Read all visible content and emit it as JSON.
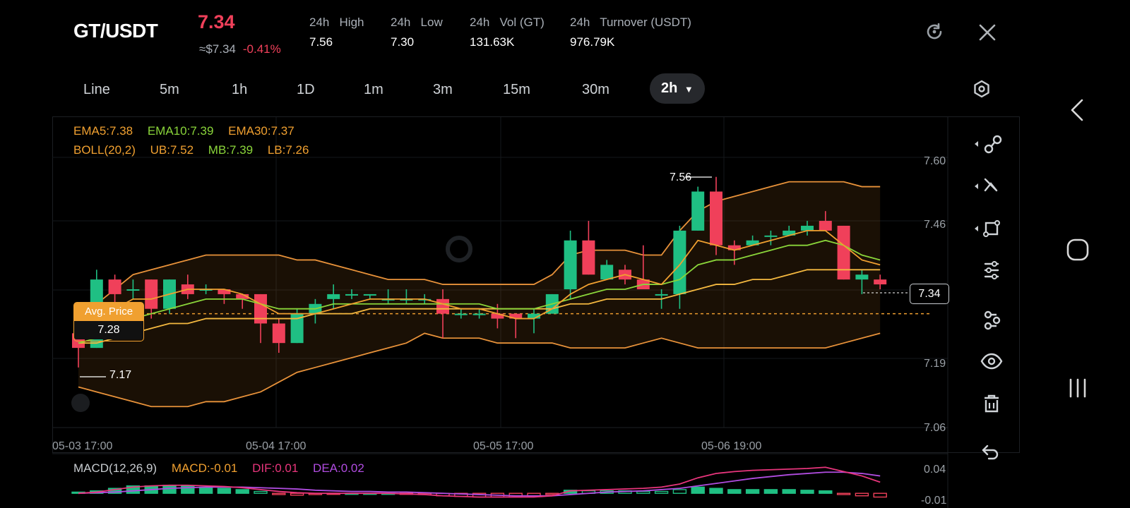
{
  "header": {
    "pair": "GT/USDT",
    "last_price": "7.34",
    "approx": "≈$7.34",
    "change": "-0.41%",
    "stats": [
      {
        "label": "24h   High",
        "value": "7.56"
      },
      {
        "label": "24h   Low",
        "value": "7.30"
      },
      {
        "label": "24h   Vol (GT)",
        "value": "131.63K"
      },
      {
        "label": "24h   Turnover (USDT)",
        "value": "976.79K"
      }
    ]
  },
  "timeframes": [
    "Line",
    "5m",
    "1h",
    "1D",
    "1m",
    "3m",
    "15m",
    "30m"
  ],
  "active_timeframe": "2h",
  "indicators": {
    "ema5": "EMA5:7.38",
    "ema10": "EMA10:7.39",
    "ema30": "EMA30:7.37",
    "boll": "BOLL(20,2)",
    "ub": "UB:7.52",
    "mb": "MB:7.39",
    "lb": "LB:7.26"
  },
  "macd_legend": {
    "title": "MACD(12,26,9)",
    "macd": "MACD:-0.01",
    "dif": "DIF:0.01",
    "dea": "DEA:0.02"
  },
  "avg_price": {
    "label": "Avg. Price",
    "value": "7.28"
  },
  "current_price_tag": "7.34",
  "high_marker": "7.56",
  "low_marker": "7.17",
  "colors": {
    "up": "#1fbf83",
    "down": "#f0405a",
    "ema5": "#f0a030",
    "ema10": "#8ad53a",
    "boll": "#e8923a",
    "dif": "#e8357c",
    "dea": "#b04ce0",
    "accent": "#f0a030"
  },
  "chart_data": {
    "type": "candlestick",
    "price_axis_ticks": [
      "7.60",
      "7.46",
      "7.19",
      "7.06"
    ],
    "macd_axis_ticks": [
      "0.04",
      "-0.01"
    ],
    "time_labels": [
      "05-03 17:00",
      "05-04 17:00",
      "05-05 17:00",
      "05-06 19:00"
    ],
    "candles": [
      [
        7.24,
        7.21,
        7.25,
        7.17
      ],
      [
        7.21,
        7.35,
        7.37,
        7.21
      ],
      [
        7.35,
        7.32,
        7.36,
        7.3
      ],
      [
        7.33,
        7.33,
        7.35,
        7.31
      ],
      [
        7.35,
        7.29,
        7.35,
        7.27
      ],
      [
        7.29,
        7.35,
        7.35,
        7.28
      ],
      [
        7.34,
        7.32,
        7.36,
        7.31
      ],
      [
        7.33,
        7.33,
        7.34,
        7.32
      ],
      [
        7.33,
        7.32,
        7.33,
        7.3
      ],
      [
        7.32,
        7.31,
        7.32,
        7.29
      ],
      [
        7.32,
        7.26,
        7.32,
        7.22
      ],
      [
        7.26,
        7.22,
        7.27,
        7.2
      ],
      [
        7.22,
        7.28,
        7.29,
        7.22
      ],
      [
        7.28,
        7.3,
        7.31,
        7.26
      ],
      [
        7.31,
        7.32,
        7.34,
        7.29
      ],
      [
        7.32,
        7.32,
        7.33,
        7.31
      ],
      [
        7.32,
        7.32,
        7.32,
        7.31
      ],
      [
        7.31,
        7.31,
        7.33,
        7.3
      ],
      [
        7.31,
        7.31,
        7.33,
        7.3
      ],
      [
        7.31,
        7.31,
        7.32,
        7.3
      ],
      [
        7.31,
        7.28,
        7.33,
        7.23
      ],
      [
        7.28,
        7.28,
        7.29,
        7.27
      ],
      [
        7.28,
        7.28,
        7.29,
        7.27
      ],
      [
        7.28,
        7.27,
        7.3,
        7.25
      ],
      [
        7.28,
        7.27,
        7.28,
        7.23
      ],
      [
        7.27,
        7.28,
        7.29,
        7.24
      ],
      [
        7.28,
        7.32,
        7.32,
        7.28
      ],
      [
        7.33,
        7.43,
        7.45,
        7.31
      ],
      [
        7.43,
        7.36,
        7.47,
        7.36
      ],
      [
        7.35,
        7.38,
        7.39,
        7.35
      ],
      [
        7.37,
        7.35,
        7.38,
        7.34
      ],
      [
        7.35,
        7.33,
        7.42,
        7.33
      ],
      [
        7.32,
        7.32,
        7.33,
        7.29
      ],
      [
        7.32,
        7.45,
        7.46,
        7.29
      ],
      [
        7.45,
        7.53,
        7.54,
        7.45
      ],
      [
        7.53,
        7.42,
        7.56,
        7.4
      ],
      [
        7.42,
        7.41,
        7.43,
        7.38
      ],
      [
        7.42,
        7.43,
        7.44,
        7.42
      ],
      [
        7.44,
        7.44,
        7.45,
        7.42
      ],
      [
        7.44,
        7.45,
        7.46,
        7.44
      ],
      [
        7.45,
        7.46,
        7.47,
        7.44
      ],
      [
        7.47,
        7.45,
        7.49,
        7.45
      ],
      [
        7.46,
        7.35,
        7.46,
        7.35
      ],
      [
        7.35,
        7.36,
        7.37,
        7.32
      ],
      [
        7.35,
        7.34,
        7.36,
        7.33
      ]
    ],
    "ema5": [
      7.23,
      7.26,
      7.29,
      7.31,
      7.31,
      7.32,
      7.33,
      7.33,
      7.33,
      7.32,
      7.3,
      7.28,
      7.28,
      7.28,
      7.29,
      7.3,
      7.31,
      7.31,
      7.31,
      7.31,
      7.3,
      7.29,
      7.29,
      7.28,
      7.27,
      7.27,
      7.29,
      7.32,
      7.34,
      7.35,
      7.36,
      7.35,
      7.34,
      7.38,
      7.43,
      7.42,
      7.41,
      7.42,
      7.43,
      7.44,
      7.45,
      7.45,
      7.42,
      7.39,
      7.38
    ],
    "ema10": [
      7.22,
      7.23,
      7.25,
      7.27,
      7.28,
      7.29,
      7.3,
      7.31,
      7.31,
      7.31,
      7.3,
      7.29,
      7.29,
      7.29,
      7.3,
      7.3,
      7.3,
      7.3,
      7.3,
      7.3,
      7.3,
      7.3,
      7.3,
      7.29,
      7.29,
      7.29,
      7.3,
      7.31,
      7.32,
      7.33,
      7.33,
      7.34,
      7.34,
      7.35,
      7.38,
      7.39,
      7.39,
      7.4,
      7.41,
      7.42,
      7.42,
      7.43,
      7.42,
      7.4,
      7.39
    ],
    "ema30": [
      7.22,
      7.22,
      7.23,
      7.24,
      7.25,
      7.26,
      7.26,
      7.27,
      7.27,
      7.27,
      7.27,
      7.27,
      7.27,
      7.28,
      7.28,
      7.28,
      7.29,
      7.29,
      7.29,
      7.29,
      7.29,
      7.29,
      7.29,
      7.29,
      7.29,
      7.29,
      7.29,
      7.3,
      7.3,
      7.31,
      7.31,
      7.31,
      7.31,
      7.32,
      7.33,
      7.34,
      7.34,
      7.35,
      7.35,
      7.36,
      7.37,
      7.37,
      7.37,
      7.37,
      7.37
    ],
    "boll_ub": [
      7.28,
      7.3,
      7.33,
      7.36,
      7.37,
      7.38,
      7.39,
      7.4,
      7.4,
      7.4,
      7.4,
      7.4,
      7.39,
      7.39,
      7.38,
      7.37,
      7.36,
      7.35,
      7.35,
      7.35,
      7.34,
      7.34,
      7.34,
      7.34,
      7.34,
      7.34,
      7.36,
      7.4,
      7.41,
      7.41,
      7.41,
      7.4,
      7.4,
      7.45,
      7.49,
      7.51,
      7.52,
      7.53,
      7.54,
      7.55,
      7.55,
      7.55,
      7.55,
      7.54,
      7.54
    ],
    "boll_lb": [
      7.13,
      7.12,
      7.11,
      7.1,
      7.09,
      7.09,
      7.09,
      7.1,
      7.1,
      7.11,
      7.12,
      7.14,
      7.16,
      7.17,
      7.18,
      7.19,
      7.2,
      7.21,
      7.22,
      7.24,
      7.23,
      7.23,
      7.23,
      7.22,
      7.22,
      7.22,
      7.22,
      7.21,
      7.21,
      7.21,
      7.21,
      7.22,
      7.23,
      7.22,
      7.21,
      7.21,
      7.21,
      7.21,
      7.21,
      7.21,
      7.21,
      7.21,
      7.22,
      7.23,
      7.24
    ],
    "macd_hist": [
      0.002,
      0.004,
      0.008,
      0.012,
      0.012,
      0.013,
      0.012,
      0.01,
      0.008,
      0.006,
      0.003,
      -0.002,
      -0.003,
      -0.002,
      -0.001,
      0.0,
      0.0,
      0.0,
      -0.001,
      -0.002,
      -0.004,
      -0.005,
      -0.006,
      -0.006,
      -0.006,
      -0.005,
      -0.002,
      0.005,
      0.004,
      0.004,
      0.004,
      0.003,
      0.003,
      0.006,
      0.01,
      0.008,
      0.006,
      0.006,
      0.006,
      0.006,
      0.005,
      0.004,
      -0.002,
      -0.004,
      -0.006
    ],
    "dif": [
      0.0,
      0.002,
      0.006,
      0.01,
      0.012,
      0.013,
      0.013,
      0.012,
      0.011,
      0.009,
      0.006,
      0.003,
      0.001,
      0.0,
      0.0,
      0.0,
      0.0,
      0.0,
      -0.001,
      -0.002,
      -0.004,
      -0.005,
      -0.006,
      -0.006,
      -0.006,
      -0.006,
      -0.004,
      0.004,
      0.005,
      0.006,
      0.007,
      0.008,
      0.01,
      0.015,
      0.025,
      0.032,
      0.035,
      0.037,
      0.038,
      0.039,
      0.04,
      0.042,
      0.035,
      0.028,
      0.018
    ],
    "dea": [
      0.0,
      0.001,
      0.002,
      0.004,
      0.006,
      0.008,
      0.009,
      0.01,
      0.01,
      0.01,
      0.009,
      0.008,
      0.007,
      0.005,
      0.004,
      0.003,
      0.003,
      0.002,
      0.002,
      0.001,
      0.0,
      -0.001,
      -0.002,
      -0.003,
      -0.004,
      -0.004,
      -0.004,
      -0.002,
      0.0,
      0.002,
      0.003,
      0.004,
      0.006,
      0.008,
      0.012,
      0.016,
      0.02,
      0.024,
      0.027,
      0.03,
      0.032,
      0.034,
      0.034,
      0.032,
      0.028
    ]
  }
}
